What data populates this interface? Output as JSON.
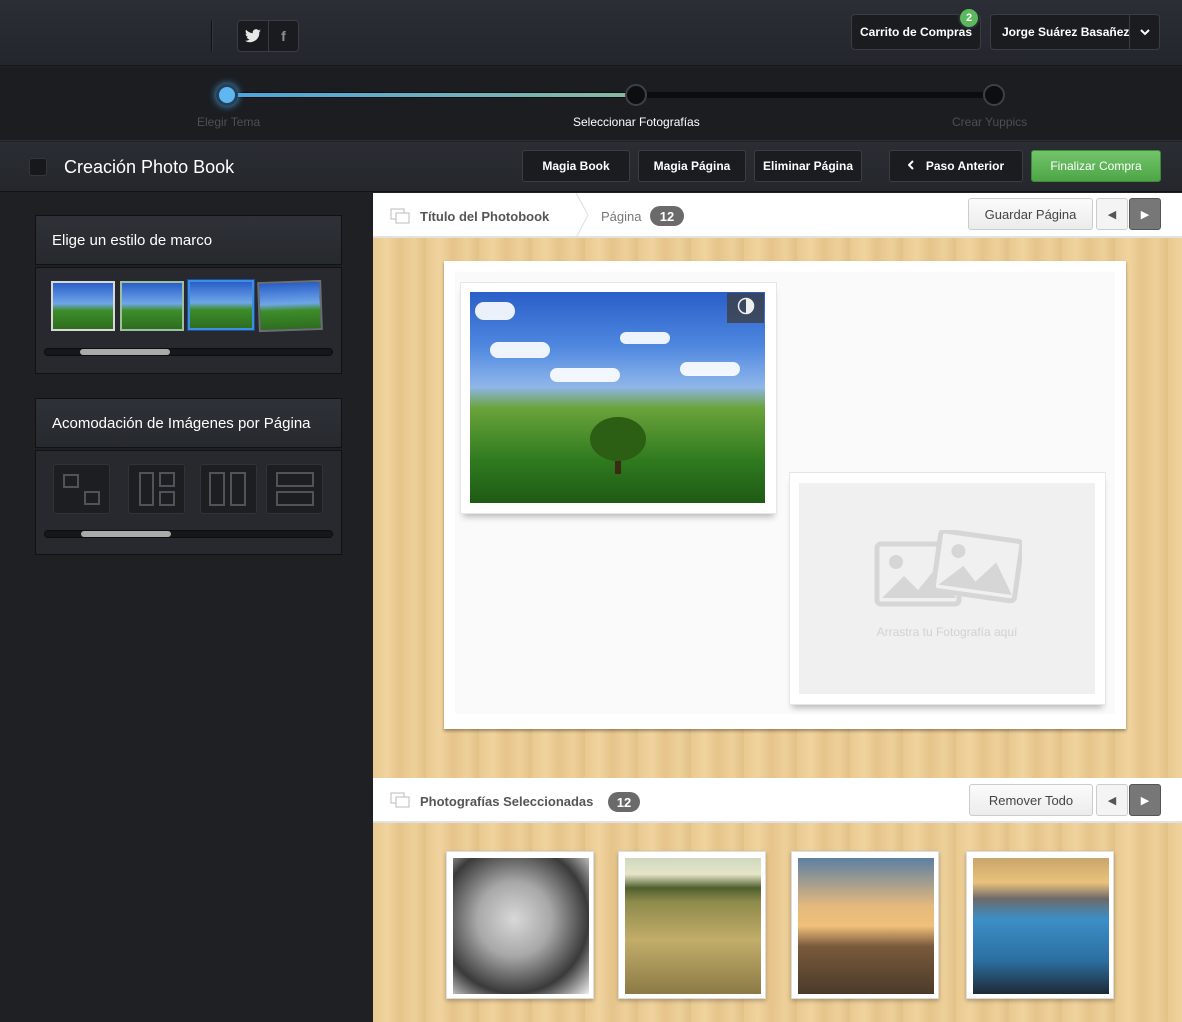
{
  "header": {
    "cart_label": "Carrito de Compras",
    "cart_count": "2",
    "user_name": "Jorge Suárez Basañez",
    "twitter_glyph": "t",
    "facebook_glyph": "f"
  },
  "steps": [
    {
      "label": "Elegir Tema"
    },
    {
      "label": "Seleccionar Fotografías"
    },
    {
      "label": "Crear  Yuppics"
    }
  ],
  "toolbar": {
    "title": "Creación Photo Book",
    "magia_book": "Magia Book",
    "magia_pagina": "Magia Página",
    "eliminar_pagina": "Eliminar Página",
    "paso_anterior": "Paso Anterior",
    "finalizar": "Finalizar Compra"
  },
  "sidebar": {
    "frame_title": "Elige un estilo de marco",
    "layout_title": "Acomodación de Imágenes por Página"
  },
  "editor": {
    "breadcrumb_title": "Título del Photobook",
    "page_label": "Página",
    "page_count": "12",
    "save_button": "Guardar Página",
    "drop_text": "Arrastra tu Fotografía aquí"
  },
  "selected": {
    "title": "Photografías Seleccionadas",
    "count": "12",
    "remove_all": "Remover Todo"
  },
  "colors": {
    "accent_blue": "#4aa5e0",
    "green_button": "#5cb85c",
    "badge_gray": "#6a6a6a"
  }
}
